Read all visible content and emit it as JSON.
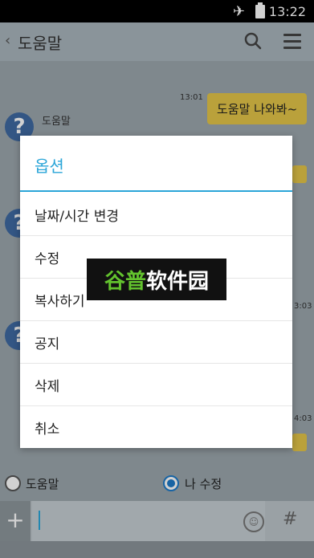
{
  "status": {
    "time": "13:22"
  },
  "header": {
    "back": "‹",
    "title": "도움말"
  },
  "messages": [
    {
      "text": "도움말 나와봐~",
      "time": "13:01"
    }
  ],
  "chat": {
    "name": "도움말",
    "partial_time_1": "3:03",
    "partial_time_2": "4:03"
  },
  "radios": [
    {
      "label": "도움말",
      "checked": false
    },
    {
      "label": "나 수정",
      "checked": true
    }
  ],
  "input": {
    "emoji": "☺",
    "hash": "#"
  },
  "dialog": {
    "title": "옵션",
    "options": [
      "날짜/시간 변경",
      "수정",
      "복사하기",
      "공지",
      "삭제",
      "취소"
    ]
  },
  "watermark": {
    "part1": "谷普",
    "part2": "软件园"
  },
  "colors": {
    "accent": "#2aa5d8",
    "bubble": "#e3c548",
    "avatar": "#3f69a1"
  }
}
